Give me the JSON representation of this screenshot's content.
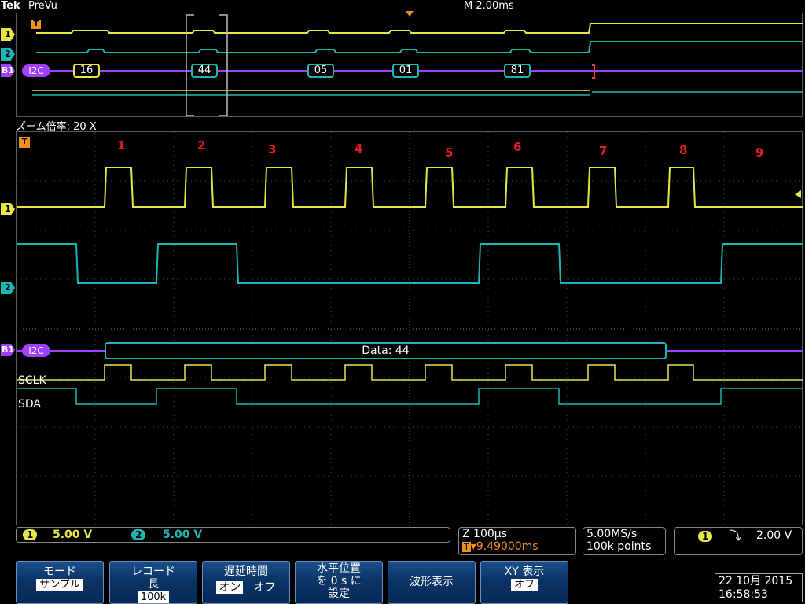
{
  "header": {
    "logo": "Tek",
    "mode": "PreVu",
    "timebase": "M 2.00ms"
  },
  "overview": {
    "bus_label": "I2C",
    "bytes": [
      "16",
      "44",
      "05",
      "01",
      "81"
    ]
  },
  "zoom": {
    "label": "ズーム倍率: 20 X"
  },
  "main": {
    "bus_label": "I2C",
    "bit_numbers": [
      "1",
      "2",
      "3",
      "4",
      "5",
      "6",
      "7",
      "8",
      "9"
    ],
    "packet_label": "Data: 44",
    "sclk_label": "SCLK",
    "sda_label": "SDA"
  },
  "markers": {
    "trigger": "T",
    "ch1": "1",
    "ch2": "2",
    "bus": "B1"
  },
  "readout": {
    "ch1_num": "1",
    "ch1_scale": "5.00 V",
    "ch2_num": "2",
    "ch2_scale": "5.00 V",
    "zoom_scale": "Z 100µs",
    "trigger_pos": "▾9.49000ms",
    "sample_rate": "5.00MS/s",
    "record_points": "100k points",
    "trig_ch": "1",
    "trig_slope": "⤵",
    "trig_level": "2.00 V"
  },
  "softkeys": [
    {
      "line1": "モード",
      "sub": "サンプル"
    },
    {
      "line1": "レコード",
      "line2": "長",
      "sub": "100k"
    },
    {
      "line1": "遅延時間",
      "on": "オン",
      "off": "オフ"
    },
    {
      "line1": "水平位置",
      "line2": "を 0 s に",
      "line3": "設定"
    },
    {
      "line1": "波形表示"
    },
    {
      "line1": "XY 表示",
      "sub": "オフ"
    }
  ],
  "clock": {
    "date": "22 10月 2015",
    "time": "16:58:53"
  },
  "colors": {
    "ch1": "#e6e64a",
    "ch2": "#1fb5b5",
    "bus": "#a040ff",
    "bit_number": "#e02020",
    "grid": "#4a4a4a"
  }
}
